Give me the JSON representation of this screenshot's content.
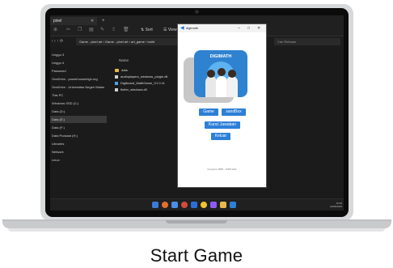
{
  "caption": "Start Game",
  "explorer": {
    "tab_label": "pixel",
    "new_tab": "+",
    "toolbar": {
      "sort_label": "Sort",
      "view_label": "View"
    },
    "nav_arrows": "‹ › ↑ ⟳",
    "path": "Game - pixel art  ›  Game - pixel art  ›  art_game  ›  build",
    "search_placeholder": "Cari Release",
    "sidebar_items": [
      "Unggu 3",
      "Unggu 4",
      "Password",
      "OneDrive - powerhousehigh.org",
      "OneDrive - Universitas Negeri Malan",
      "This PC",
      "Windows SSD (C:)",
      "Data (D:)",
      "Data (E:)",
      "Data (F:)",
      "Data Podcast (H:)",
      "Libraries",
      "Network",
      "Linux"
    ],
    "column_header": "Name",
    "files": [
      {
        "name": "data",
        "type": "folder"
      },
      {
        "name": "audioplayers_windows_plugin.dll",
        "type": "file"
      },
      {
        "name": "Digiboard_MathGame_V1.0.11",
        "type": "flutter"
      },
      {
        "name": "flutter_windows.dll",
        "type": "file"
      }
    ]
  },
  "app": {
    "title": "digimath",
    "logo_text": "DIGIMATH",
    "buttons": {
      "game": "Game",
      "sandbox": "sandBox",
      "key": "Kunci Jawaban",
      "exit": "Keluar"
    },
    "footer": "Develop by PBMT - FMIPA 2024"
  },
  "taskbar": {
    "time": "15:00",
    "date": "19/05/2024"
  },
  "colors": {
    "accent": "#2d7fd8",
    "folder": "#e8b84a",
    "screen_bg": "#1b1b1b"
  }
}
